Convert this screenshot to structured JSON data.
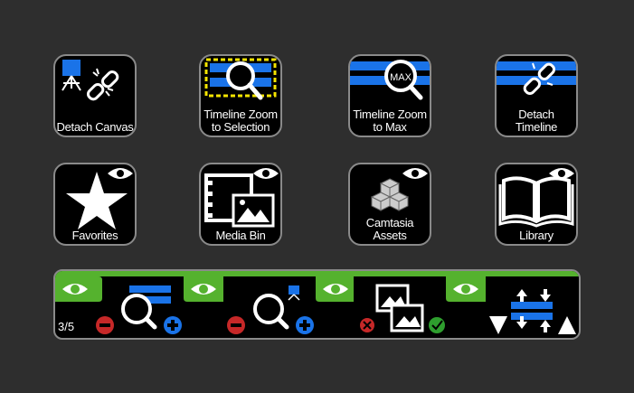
{
  "colors": {
    "background": "#2e2e2e",
    "tile_fill": "#000000",
    "tile_border": "#8a8a8a",
    "accent_blue": "#1a73e8",
    "accent_yellow": "#f5e400",
    "accent_green": "#55b22e",
    "minus_red": "#c62828",
    "check_green": "#2e9e2e"
  },
  "tiles": [
    {
      "label": "Detach Canvas",
      "icon": "detach-canvas-icon"
    },
    {
      "label": "Timeline Zoom to Selection",
      "icon": "zoom-selection-icon"
    },
    {
      "label": "Timeline Zoom to Max",
      "icon": "zoom-max-icon",
      "badge": "MAX"
    },
    {
      "label": "Detach Timeline",
      "icon": "detach-timeline-icon"
    },
    {
      "label": "Favorites",
      "icon": "star-icon"
    },
    {
      "label": "Media Bin",
      "icon": "media-bin-icon"
    },
    {
      "label": "Camtasia Assets",
      "icon": "assets-cubes-icon"
    },
    {
      "label": "Library",
      "icon": "library-book-icon"
    }
  ],
  "strip": {
    "page_indicator": "3/5",
    "segments": [
      "timeline-zoom-segment",
      "canvas-zoom-segment",
      "media-navigate-segment",
      "track-navigate-segment"
    ]
  }
}
